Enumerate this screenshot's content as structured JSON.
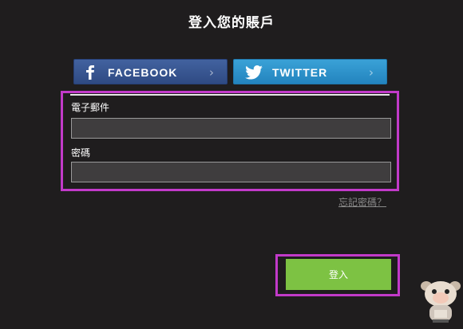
{
  "header": {
    "title": "登入您的賬戶"
  },
  "social": {
    "facebook": {
      "label": "FACEBOOK",
      "icon": "facebook-icon",
      "color": "#3b5998"
    },
    "twitter": {
      "label": "TWITTER",
      "icon": "twitter-icon",
      "color": "#2d96cf"
    }
  },
  "form": {
    "email_label": "電子郵件",
    "email_value": "",
    "password_label": "密碼",
    "password_value": "",
    "forgot_link": "忘記密碼？"
  },
  "actions": {
    "login_label": "登入",
    "login_color": "#7dc243"
  },
  "highlight_color": "#c23ac9",
  "decor": {
    "mascot": "mascot-watermark-icon"
  }
}
